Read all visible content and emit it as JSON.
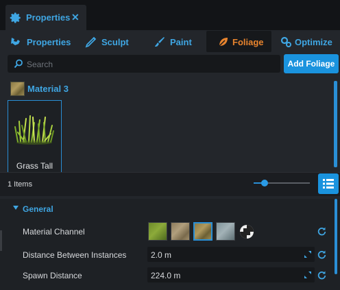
{
  "window": {
    "tab_label": "Properties",
    "tab_close": "✕"
  },
  "subtabs": [
    {
      "label": "Properties",
      "icon": "properties-icon",
      "active": false
    },
    {
      "label": "Sculpt",
      "icon": "sculpt-icon",
      "active": false
    },
    {
      "label": "Paint",
      "icon": "paint-brush-icon",
      "active": false
    },
    {
      "label": "Foliage",
      "icon": "leaf-icon",
      "active": true
    },
    {
      "label": "Optimize",
      "icon": "optimize-icon",
      "active": false
    }
  ],
  "search": {
    "placeholder": "Search",
    "value": ""
  },
  "add_foliage_label": "Add Foliage",
  "material": {
    "title": "Material 3"
  },
  "assets": [
    {
      "name": "Grass Tall",
      "selected": true
    }
  ],
  "items_count": "1 Items",
  "thumbnail_size_slider": 0.2,
  "general": {
    "header": "General",
    "material_channel_label": "Material Channel",
    "selected_channel_index": 2,
    "distance_label": "Distance Between Instances",
    "distance_value": "2.0 m",
    "spawn_label": "Spawn Distance",
    "spawn_value": "224.0 m"
  },
  "colors": {
    "accent": "#3fa6e3",
    "active_tab": "#e8842e",
    "button": "#1a93de",
    "panel": "#23262b"
  }
}
